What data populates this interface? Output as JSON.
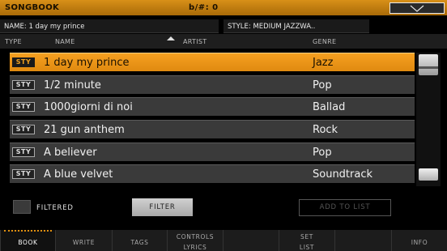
{
  "topbar": {
    "title": "SONGBOOK",
    "transpose": "b/#: 0"
  },
  "info": {
    "name": "NAME: 1 day my prince",
    "style": "STYLE: MEDIUM JAZZWA.."
  },
  "columns": {
    "type": "TYPE",
    "name": "NAME",
    "artist": "ARTIST",
    "genre": "GENRE"
  },
  "rows": [
    {
      "type": "STY",
      "name": "1 day my prince",
      "genre": "Jazz"
    },
    {
      "type": "STY",
      "name": "1/2 minute",
      "genre": "Pop"
    },
    {
      "type": "STY",
      "name": "1000giorni di noi",
      "genre": "Ballad"
    },
    {
      "type": "STY",
      "name": "21 gun anthem",
      "genre": "Rock"
    },
    {
      "type": "STY",
      "name": "A believer",
      "genre": "Pop"
    },
    {
      "type": "STY",
      "name": "A blue velvet",
      "genre": "Soundtrack"
    }
  ],
  "controls": {
    "filtered_label": "FILTERED",
    "filter_button": "FILTER",
    "add_to_list_button": "ADD TO LIST"
  },
  "tabs": {
    "book": "BOOK",
    "write": "WRITE",
    "tags": "TAGS",
    "controls_lyrics_1": "CONTROLS",
    "controls_lyrics_2": "LYRICS",
    "set_list_1": "SET",
    "set_list_2": "LIST",
    "info": "INFO"
  },
  "colors": {
    "accent": "#e08a10",
    "row": "#3a3a3a",
    "background": "#000000"
  }
}
